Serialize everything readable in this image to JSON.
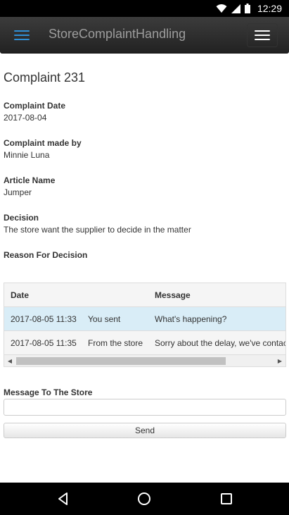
{
  "status_bar": {
    "time": "12:29"
  },
  "navbar": {
    "title": "StoreComplaintHandling"
  },
  "complaint": {
    "title": "Complaint 231",
    "fields": [
      {
        "label": "Complaint Date",
        "value": "2017-08-04"
      },
      {
        "label": "Complaint made by",
        "value": "Minnie Luna"
      },
      {
        "label": "Article Name",
        "value": "Jumper"
      },
      {
        "label": "Decision",
        "value": "The store want the supplier to decide in the matter"
      },
      {
        "label": "Reason For Decision",
        "value": ""
      }
    ]
  },
  "messages": {
    "headers": {
      "date": "Date",
      "message": "Message"
    },
    "rows": [
      {
        "date": "2017-08-05 11:33",
        "sender": "You sent",
        "message": "What's happening?"
      },
      {
        "date": "2017-08-05 11:35",
        "sender": "From the store",
        "message": "Sorry about the delay, we've contac"
      }
    ]
  },
  "form": {
    "message_label": "Message To The Store",
    "message_value": "",
    "send_label": "Send"
  }
}
